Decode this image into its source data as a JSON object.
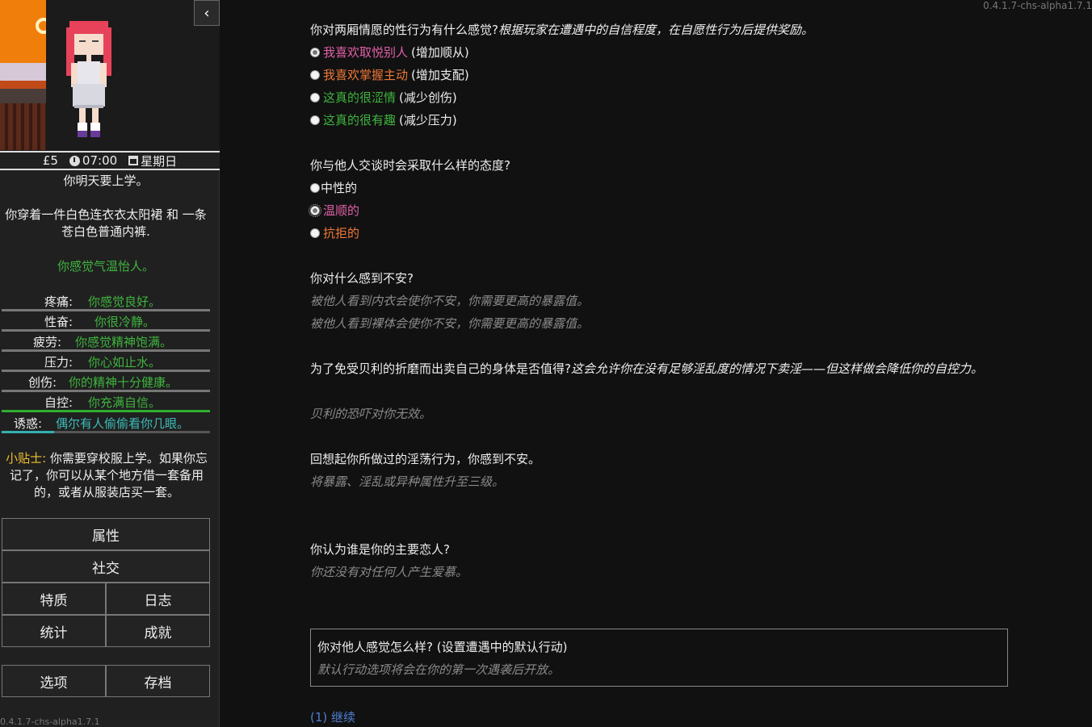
{
  "sidebar": {
    "money": "£5",
    "time": "07:00",
    "day": "星期日",
    "school_notice": "你明天要上学。",
    "clothing": "你穿着一件白色连衣衣太阳裙 和 一条苍白色普通内裤.",
    "weather": "你感觉气温怡人。",
    "meters": [
      {
        "label": "疼痛:",
        "value": "你感觉良好。",
        "level": 1
      },
      {
        "label": "性奋:",
        "value": "你很冷静。",
        "level": 1
      },
      {
        "label": "疲劳:",
        "value": "你感觉精神饱满。",
        "level": 1
      },
      {
        "label": "压力:",
        "value": "你心如止水。",
        "level": 1
      },
      {
        "label": "创伤:",
        "value": "你的精神十分健康。",
        "level": 1
      },
      {
        "label": "自控:",
        "value": "你充满自信。",
        "level": 1
      },
      {
        "label": "诱惑:",
        "value": "偶尔有人偷偷看你几眼。",
        "level": 0.25
      }
    ],
    "tip_label": "小贴士:",
    "tip_text": "你需要穿校服上学。如果你忘记了，你可以从某个地方借一套备用的，或者从服装店买一套。",
    "buttons": {
      "attributes": "属性",
      "social": "社交",
      "traits": "特质",
      "journal": "日志",
      "statistics": "统计",
      "achievements": "成就",
      "options": "选项",
      "saves": "存档"
    },
    "collapse_icon": "‹",
    "version": "0.4.1.7-chs-alpha1.7.1"
  },
  "main": {
    "version": "0.4.1.7-chs-alpha1.7.1",
    "q1": {
      "question": "你对两厢情愿的性行为有什么感觉?",
      "note": "根据玩家在遭遇中的自信程度，在自愿性行为后提供奖励。",
      "options": [
        {
          "text": "我喜欢取悦别人",
          "suffix": "(增加顺从)",
          "color": "#e060a8",
          "selected": true
        },
        {
          "text": "我喜欢掌握主动",
          "suffix": "(增加支配)",
          "color": "#f07838",
          "selected": false
        },
        {
          "text": "这真的很涩情",
          "suffix": "(减少创伤)",
          "color": "#3fb43f",
          "selected": false
        },
        {
          "text": "这真的很有趣",
          "suffix": "(减少压力)",
          "color": "#3fb43f",
          "selected": false
        }
      ]
    },
    "q2": {
      "question": "你与他人交谈时会采取什么样的态度?",
      "options": [
        {
          "text": "中性的",
          "color": "#eeeeee",
          "selected": false
        },
        {
          "text": "温顺的",
          "color": "#e060a8",
          "selected": true
        },
        {
          "text": "抗拒的",
          "color": "#f07838",
          "selected": false
        }
      ]
    },
    "q3": {
      "question": "你对什么感到不安?",
      "lines": [
        "被他人看到内衣会使你不安，你需要更高的暴露值。",
        "被他人看到裸体会使你不安，你需要更高的暴露值。"
      ]
    },
    "q4": {
      "question": "为了免受贝利的折磨而出卖自己的身体是否值得?",
      "note": "这会允许你在没有足够淫乱度的情况下卖淫——但这样做会降低你的自控力。",
      "status": "贝利的恐吓对你无效。"
    },
    "q5": {
      "question": "回想起你所做过的淫荡行为，你感到不安。",
      "status": "将暴露、淫乱或异种属性升至三级。"
    },
    "q6": {
      "question": "你认为谁是你的主要恋人?",
      "status": "你还没有对任何人产生爱慕。"
    },
    "default_action": {
      "title": "你对他人感觉怎么样? (设置遭遇中的默认行动)",
      "note": "默认行动选项将会在你的第一次遇袭后开放。"
    },
    "continue": "(1) 继续"
  }
}
